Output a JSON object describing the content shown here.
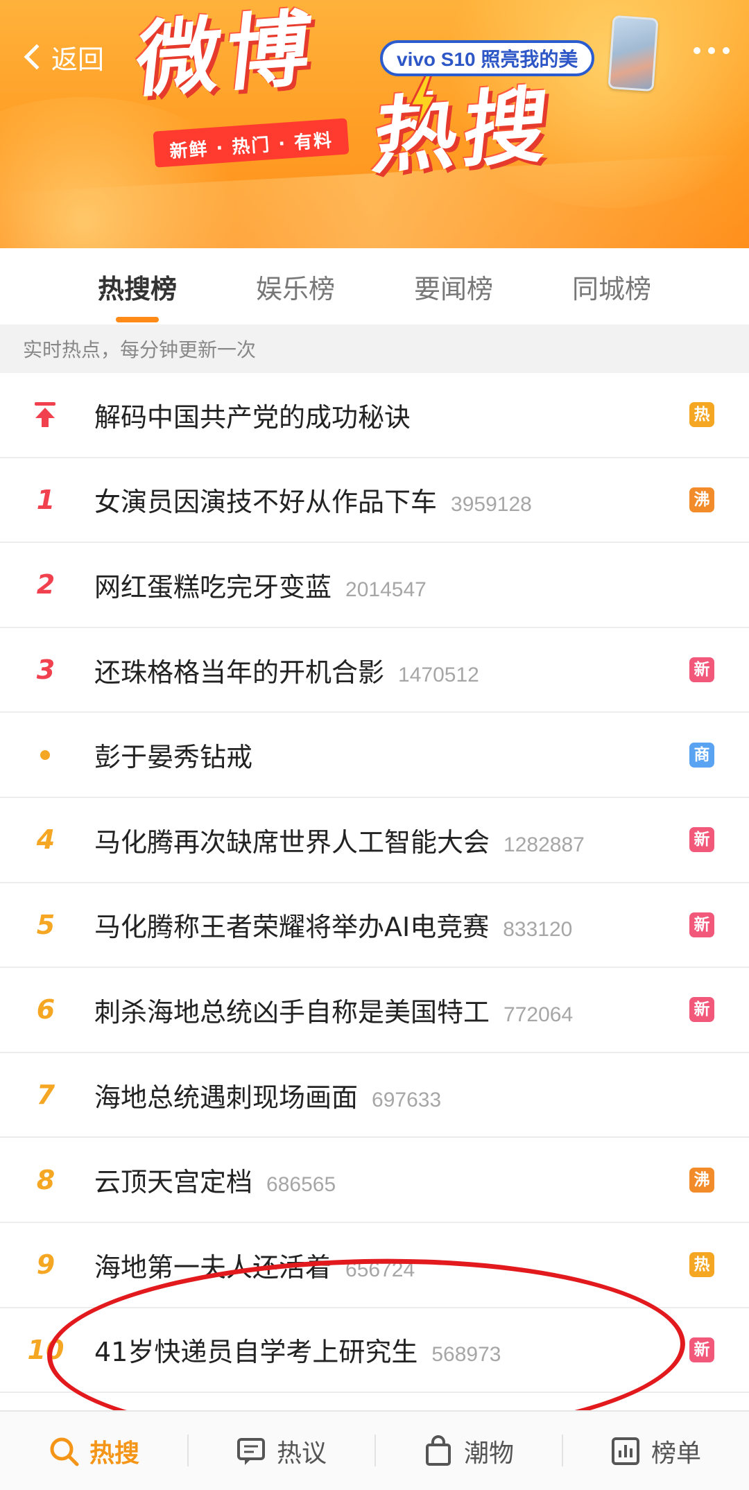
{
  "header": {
    "back_label": "返回",
    "logo_line1": "微博",
    "logo_line2": "热搜",
    "slogan": "新鲜 · 热门 · 有料",
    "ad_text": "vivo S10 照亮我的美",
    "back_icon": "chevron-left-icon",
    "more_icon": "more-dots-icon"
  },
  "tabs": [
    {
      "label": "热搜榜",
      "active": true
    },
    {
      "label": "娱乐榜",
      "active": false
    },
    {
      "label": "要闻榜",
      "active": false
    },
    {
      "label": "同城榜",
      "active": false
    }
  ],
  "subtitle": "实时热点，每分钟更新一次",
  "list": [
    {
      "rank": "",
      "marker": "pin-top-icon",
      "title": "解码中国共产党的成功秘诀",
      "count": "",
      "badge": "热",
      "badge_color": "#f5a623"
    },
    {
      "rank": "1",
      "title": "女演员因演技不好从作品下车",
      "count": "3959128",
      "badge": "沸",
      "badge_color": "#f28b2a"
    },
    {
      "rank": "2",
      "title": "网红蛋糕吃完牙变蓝",
      "count": "2014547",
      "badge": "",
      "badge_color": ""
    },
    {
      "rank": "3",
      "title": "还珠格格当年的开机合影",
      "count": "1470512",
      "badge": "新",
      "badge_color": "#f2587a"
    },
    {
      "rank": "",
      "marker": "dot-icon",
      "title": "彭于晏秀钻戒",
      "count": "",
      "badge": "商",
      "badge_color": "#5aa3f2"
    },
    {
      "rank": "4",
      "title": "马化腾再次缺席世界人工智能大会",
      "count": "1282887",
      "badge": "新",
      "badge_color": "#f2587a"
    },
    {
      "rank": "5",
      "title": "马化腾称王者荣耀将举办AI电竞赛",
      "count": "833120",
      "badge": "新",
      "badge_color": "#f2587a"
    },
    {
      "rank": "6",
      "title": "刺杀海地总统凶手自称是美国特工",
      "count": "772064",
      "badge": "新",
      "badge_color": "#f2587a"
    },
    {
      "rank": "7",
      "title": "海地总统遇刺现场画面",
      "count": "697633",
      "badge": "",
      "badge_color": ""
    },
    {
      "rank": "8",
      "title": "云顶天宫定档",
      "count": "686565",
      "badge": "沸",
      "badge_color": "#f28b2a"
    },
    {
      "rank": "9",
      "title": "海地第一夫人还活着",
      "count": "656724",
      "badge": "热",
      "badge_color": "#f5a623"
    },
    {
      "rank": "10",
      "title": "41岁快递员自学考上研究生",
      "count": "568973",
      "badge": "新",
      "badge_color": "#f2587a"
    }
  ],
  "bottom_nav": [
    {
      "label": "热搜",
      "icon": "search-icon",
      "active": true
    },
    {
      "label": "热议",
      "icon": "comment-icon",
      "active": false
    },
    {
      "label": "潮物",
      "icon": "shopping-bag-icon",
      "active": false
    },
    {
      "label": "榜单",
      "icon": "bar-chart-icon",
      "active": false
    }
  ],
  "colors": {
    "accent": "#f49518",
    "top_rank": "#f1414e",
    "rank": "#f5a623",
    "annotation": "#e2191d"
  }
}
